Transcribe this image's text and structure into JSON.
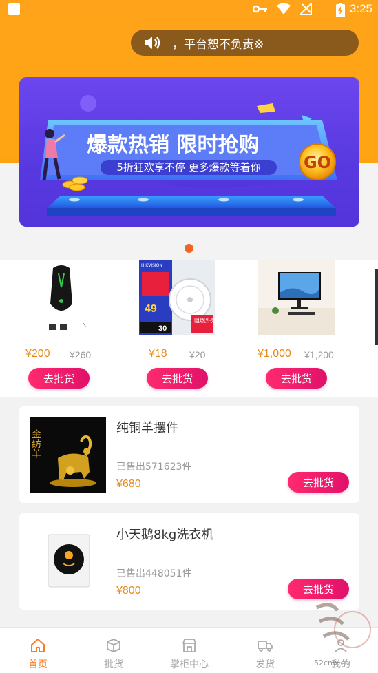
{
  "status_bar": {
    "time": "3:25"
  },
  "notice": {
    "text": "，平台恕不负责※"
  },
  "banner": {
    "headline": "爆款热销 限时抢购",
    "subline": "5折狂欢享不停 更多爆款等着你",
    "go_label": "GO"
  },
  "products": [
    {
      "price": "¥200",
      "original_price": "¥260",
      "button": "去批货",
      "image": "gaming-mouse"
    },
    {
      "price": "¥18",
      "original_price": "¥20",
      "button": "去批货",
      "image": "smoke-detector",
      "image_text": {
        "brand": "HIKVISION",
        "promo": "阻燃外壳",
        "number": "49",
        "bottom": "30"
      }
    },
    {
      "price": "¥1,000",
      "original_price": "¥1,200",
      "button": "去批货",
      "image": "monitor"
    }
  ],
  "list_items": [
    {
      "title": "纯铜羊摆件",
      "sold": "已售出571623件",
      "price": "¥680",
      "button": "去批货",
      "image": "copper-goat",
      "image_text": "金纺羊"
    },
    {
      "title": "小天鹅8kg洗衣机",
      "sold": "已售出448051件",
      "price": "¥800",
      "button": "去批货",
      "image": "washing-machine"
    }
  ],
  "tabs": [
    {
      "label": "首页",
      "icon": "home-icon",
      "active": true
    },
    {
      "label": "批货",
      "icon": "box-icon",
      "active": false
    },
    {
      "label": "掌柜中心",
      "icon": "store-icon",
      "active": false
    },
    {
      "label": "发货",
      "icon": "truck-icon",
      "active": false
    },
    {
      "label": "我的",
      "icon": "user-icon",
      "active": false
    }
  ],
  "watermark": {
    "text": "52cnw.cn"
  },
  "colors": {
    "header": "#ffa41a",
    "accent": "#ff2a6e",
    "price": "#e88a17",
    "active_tab": "#ff7a1c"
  }
}
